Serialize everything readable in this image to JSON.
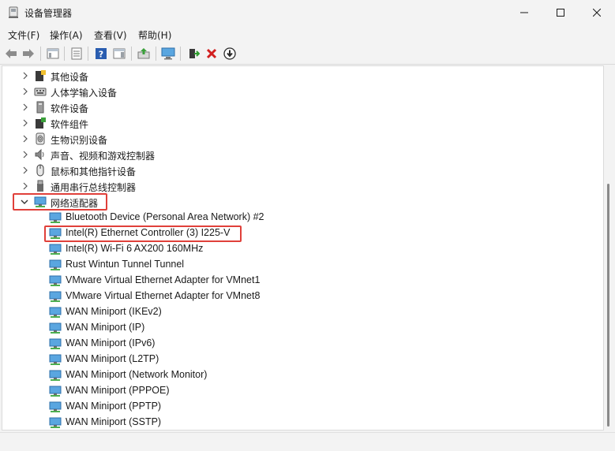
{
  "window": {
    "title": "设备管理器",
    "icon": "device-manager-icon",
    "controls": [
      "minimize-icon",
      "maximize-icon",
      "close-icon"
    ]
  },
  "menu": {
    "file": "文件(F)",
    "action": "操作(A)",
    "view": "查看(V)",
    "help": "帮助(H)"
  },
  "toolbar": {
    "buttons": [
      "back-icon",
      "forward-icon",
      "show-hide-tree-icon",
      "properties-icon",
      "help-icon",
      "action-pane-icon",
      "update-driver-icon",
      "scan-hardware-icon",
      "enable-device-icon",
      "uninstall-device-icon",
      "download-icon"
    ]
  },
  "tree": {
    "categories": [
      {
        "label": "其他设备",
        "icon": "other-devices-icon",
        "expanded": false
      },
      {
        "label": "人体学输入设备",
        "icon": "hid-icon",
        "expanded": false
      },
      {
        "label": "软件设备",
        "icon": "software-device-icon",
        "expanded": false
      },
      {
        "label": "软件组件",
        "icon": "software-component-icon",
        "expanded": false
      },
      {
        "label": "生物识别设备",
        "icon": "biometric-icon",
        "expanded": false
      },
      {
        "label": "声音、视频和游戏控制器",
        "icon": "audio-icon",
        "expanded": false
      },
      {
        "label": "鼠标和其他指针设备",
        "icon": "mouse-icon",
        "expanded": false
      },
      {
        "label": "通用串行总线控制器",
        "icon": "usb-icon",
        "expanded": false
      },
      {
        "label": "网络适配器",
        "icon": "network-adapter-icon",
        "expanded": true
      }
    ],
    "network_adapters": [
      {
        "label": "Bluetooth Device (Personal Area Network) #2"
      },
      {
        "label": "Intel(R) Ethernet Controller (3) I225-V",
        "highlighted": true
      },
      {
        "label": "Intel(R) Wi-Fi 6 AX200 160MHz"
      },
      {
        "label": "Rust Wintun Tunnel Tunnel"
      },
      {
        "label": "VMware Virtual Ethernet Adapter for VMnet1"
      },
      {
        "label": "VMware Virtual Ethernet Adapter for VMnet8"
      },
      {
        "label": "WAN Miniport (IKEv2)"
      },
      {
        "label": "WAN Miniport (IP)"
      },
      {
        "label": "WAN Miniport (IPv6)"
      },
      {
        "label": "WAN Miniport (L2TP)"
      },
      {
        "label": "WAN Miniport (Network Monitor)"
      },
      {
        "label": "WAN Miniport (PPPOE)"
      },
      {
        "label": "WAN Miniport (PPTP)"
      },
      {
        "label": "WAN Miniport (SSTP)"
      }
    ]
  },
  "colors": {
    "highlight_box": "#e0403a",
    "network_icon": "#2f8fd8"
  }
}
